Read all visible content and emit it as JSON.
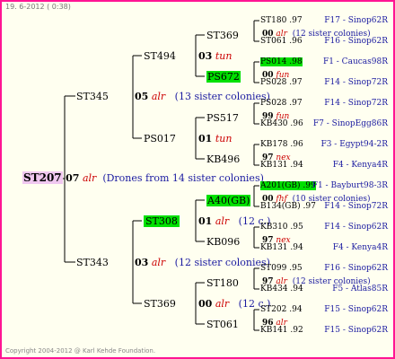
{
  "date": "19. 6-2012 ( 0:38)",
  "footer": "Copyright 2004-2012 @ Karl Kehde Foundation.",
  "root": {
    "name": "ST207",
    "year": "07",
    "mating": "alr",
    "note": "(Drones from 14 sister colonies)"
  },
  "gen1": [
    {
      "name": "ST345",
      "year": "05",
      "mating": "alr",
      "note": "(13 sister colonies)"
    },
    {
      "name": "ST343",
      "year": "03",
      "mating": "alr",
      "note": "(12 sister colonies)"
    }
  ],
  "gen2": [
    {
      "name": "ST494",
      "year": "03",
      "mating": "tun",
      "note": ""
    },
    {
      "name": "PS017",
      "year": "01",
      "mating": "tun",
      "note": ""
    },
    {
      "name": "ST308",
      "year": "01",
      "mating": "alr",
      "note": "(12 c.)"
    },
    {
      "name": "ST369",
      "year": "00",
      "mating": "alr",
      "note": "(12 c.)"
    }
  ],
  "gen3": [
    {
      "name": "ST369",
      "year": "00",
      "mating": "alr",
      "note": "(12 sister colonies)"
    },
    {
      "name": "PS672",
      "year": "00",
      "mating": "fun",
      "note": ""
    },
    {
      "name": "PS517",
      "year": "99",
      "mating": "fun",
      "note": ""
    },
    {
      "name": "KB496",
      "year": "97",
      "mating": "nex",
      "note": ""
    },
    {
      "name": "A40(GB)",
      "year": "00",
      "mating": "fhf",
      "note": "(10 sister colonies)"
    },
    {
      "name": "KB096",
      "year": "97",
      "mating": "nex",
      "note": ""
    },
    {
      "name": "ST180",
      "year": "97",
      "mating": "alr",
      "note": "(12 sister colonies)"
    },
    {
      "name": "ST061",
      "year": "96",
      "mating": "alr",
      "note": ""
    }
  ],
  "gen4": [
    {
      "name": "ST180",
      "year": ".97",
      "src": "F17 - Sinop62R"
    },
    {
      "name": "ST061",
      "year": ".96",
      "src": "F16 - Sinop62R"
    },
    {
      "name": "PS014",
      "year": ".98",
      "src": "F1 - Caucas98R"
    },
    {
      "name": "PS028",
      "year": ".97",
      "src": "F14 - Sinop72R"
    },
    {
      "name": "PS028",
      "year": ".97",
      "src": "F14 - Sinop72R"
    },
    {
      "name": "KB430",
      "year": ".96",
      "src": "F7 - SinopEgg86R"
    },
    {
      "name": "KB178",
      "year": ".96",
      "src": "F3 - Egypt94-2R"
    },
    {
      "name": "KB131",
      "year": ".94",
      "src": "F4 - Kenya4R"
    },
    {
      "name": "A201(GB)",
      "year": ".99",
      "src": "F1 - Bayburt98-3R"
    },
    {
      "name": "B134(GB)",
      "year": ".97",
      "src": "F14 - Sinop72R"
    },
    {
      "name": "KB310",
      "year": ".95",
      "src": "F14 - Sinop62R"
    },
    {
      "name": "KB131",
      "year": ".94",
      "src": "F4 - Kenya4R"
    },
    {
      "name": "ST099",
      "year": ".95",
      "src": "F16 - Sinop62R"
    },
    {
      "name": "KB434",
      "year": ".94",
      "src": "F5 - Atlas85R"
    },
    {
      "name": "ST202",
      "year": ".94",
      "src": "F15 - Sinop62R"
    },
    {
      "name": "KB141",
      "year": ".92",
      "src": "F15 - Sinop62R"
    }
  ]
}
